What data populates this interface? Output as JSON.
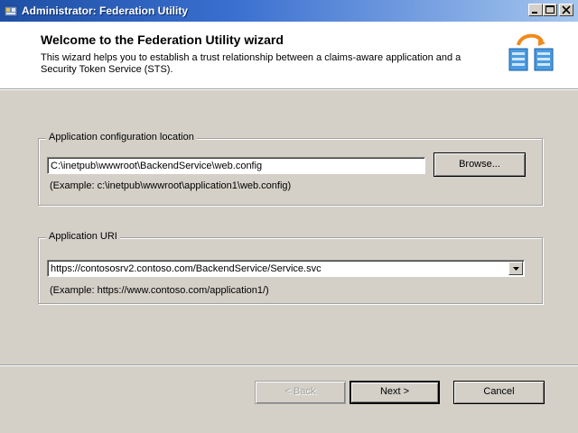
{
  "window": {
    "title": "Administrator: Federation Utility"
  },
  "header": {
    "title": "Welcome to the Federation Utility wizard",
    "description": "This wizard helps you to establish a trust relationship between a claims-aware application and a Security Token Service (STS).",
    "art_icon": "federation-wizard-icon"
  },
  "config_group": {
    "legend": "Application configuration location",
    "value": "C:\\inetpub\\wwwroot\\BackendService\\web.config",
    "browse_label": "Browse...",
    "example": "(Example: c:\\inetpub\\wwwroot\\application1\\web.config)"
  },
  "uri_group": {
    "legend": "Application URI",
    "value": "https://contososrv2.contoso.com/BackendService/Service.svc",
    "example": "(Example: https://www.contoso.com/application1/)"
  },
  "footer": {
    "back_label": "< Back",
    "next_label": "Next >",
    "cancel_label": "Cancel"
  },
  "colors": {
    "titlebar_start": "#1e4fa4",
    "titlebar_end": "#a6c6ee",
    "dialog_bg": "#d4d0c8"
  }
}
